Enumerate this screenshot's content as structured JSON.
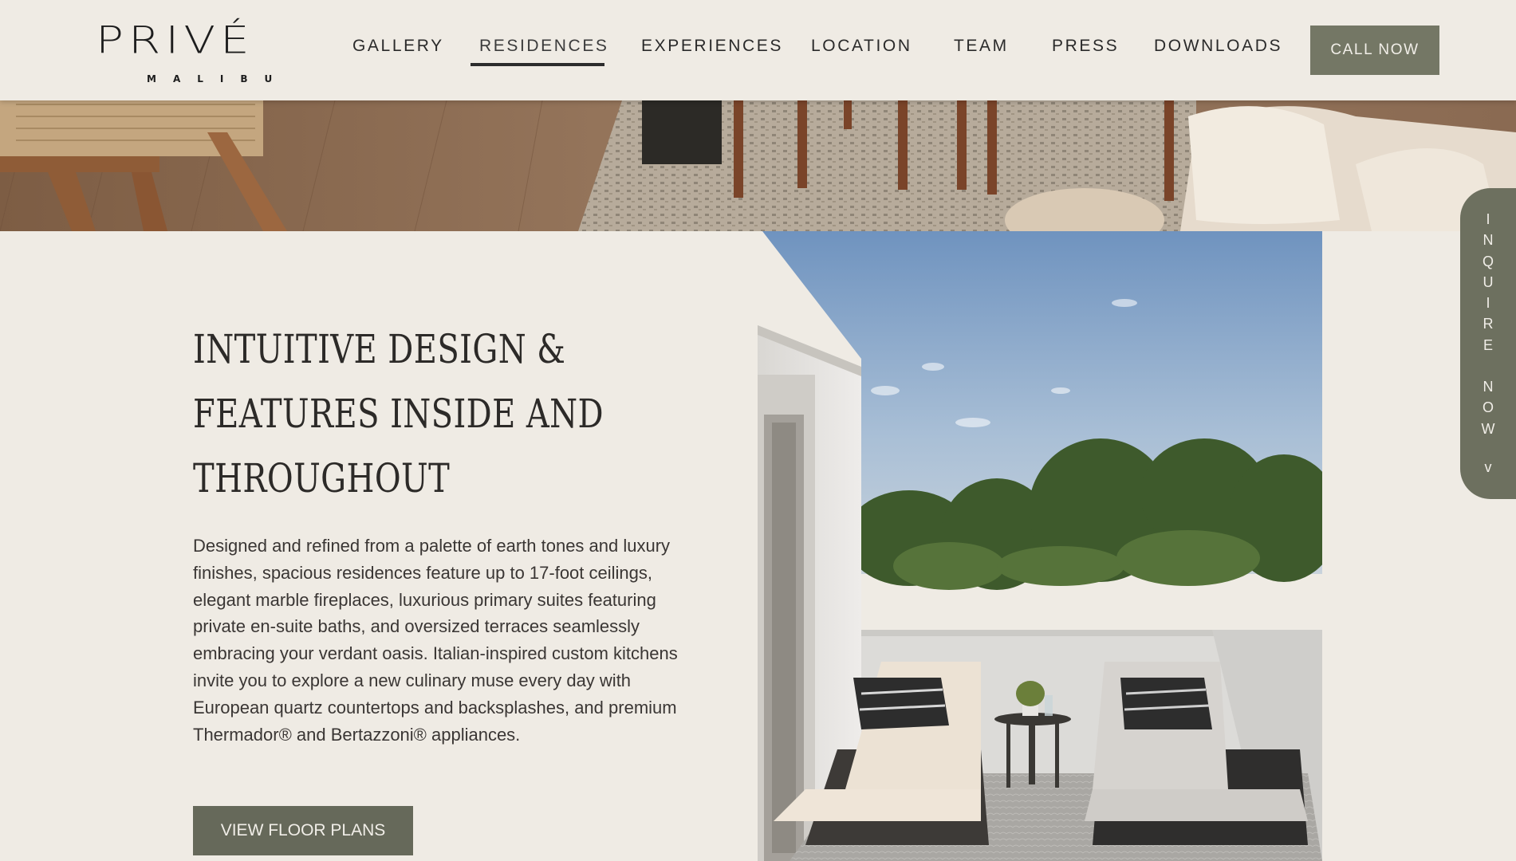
{
  "brand": {
    "name": "PRIVÉ",
    "location": "MALIBU"
  },
  "nav": {
    "items": [
      {
        "label": "GALLERY"
      },
      {
        "label": "RESIDENCES"
      },
      {
        "label": "EXPERIENCES"
      },
      {
        "label": "LOCATION"
      },
      {
        "label": "TEAM"
      },
      {
        "label": "PRESS"
      },
      {
        "label": "DOWNLOADS"
      }
    ],
    "active": "RESIDENCES",
    "cta_label": "CALL NOW"
  },
  "section": {
    "headline": "INTUITIVE DESIGN & FEATURES INSIDE AND THROUGHOUT",
    "body": "Designed and refined from a palette of earth tones and luxury finishes, spacious residences feature up to 17-foot ceilings, elegant marble fireplaces, luxurious primary suites featuring private en-suite baths, and oversized terraces seamlessly embracing your verdant oasis. Italian-inspired custom kitchens invite you to explore a new culinary muse every day with European quartz countertops and backsplashes, and premium Thermador® and Bertazzoni® appliances.",
    "button_label": "VIEW FLOOR PLANS"
  },
  "inquire_tab": {
    "word1": [
      "I",
      "N",
      "Q",
      "U",
      "I",
      "R",
      "E"
    ],
    "word2": [
      "N",
      "O",
      "W"
    ],
    "chevron": "v"
  },
  "colors": {
    "background": "#efebe4",
    "accent_olive": "#747765",
    "button_dark_olive": "#66695a",
    "text_dark": "#2c2a28"
  }
}
